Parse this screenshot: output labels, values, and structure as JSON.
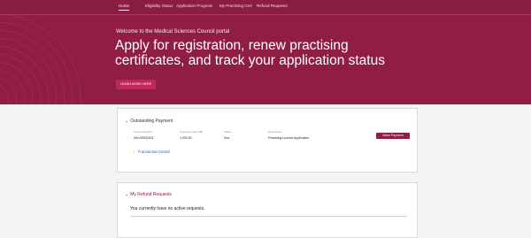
{
  "nav": {
    "items": [
      {
        "label": "Home"
      },
      {
        "label": "Eligibility Status"
      },
      {
        "label": "Application Progress"
      },
      {
        "label": "My Practising Cert"
      },
      {
        "label": "Refund Requests"
      }
    ]
  },
  "hero": {
    "welcome": "Welcome to the Medical Sciences Council portal",
    "title": "Apply for registration, renew practising certificates, and track your application status",
    "button_label": "LEARN MORE HERE"
  },
  "payments": {
    "toggle_label": "Outstanding Payment",
    "columns": [
      {
        "header": "Invoice Number",
        "value": "INV-00031424"
      },
      {
        "header": "Amount to Pay (S$)",
        "value": "1,000.00"
      },
      {
        "header": "Status",
        "value": "Due"
      },
      {
        "header": "Description",
        "value": "Practising Licence Application"
      }
    ],
    "pay_button_label": "Make Payment",
    "transaction_link": "Transaction Detail"
  },
  "refunds": {
    "toggle_label": "My Refund Requests",
    "empty_text": "You currently have no active requests."
  },
  "colors": {
    "brand": "#8f1d46",
    "accent": "#bd2a58",
    "link": "#2a6aa8"
  }
}
